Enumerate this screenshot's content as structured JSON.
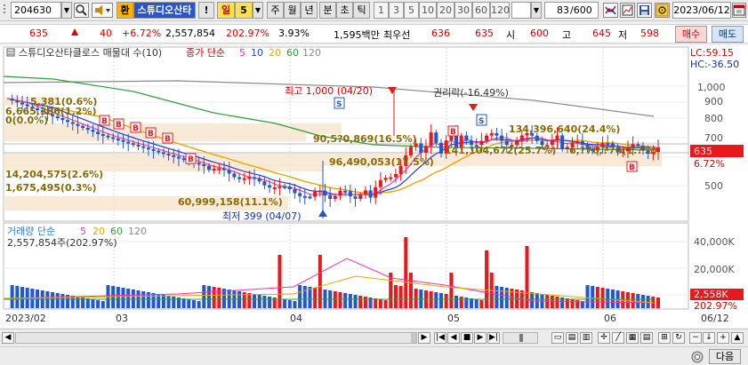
{
  "toolbar": {
    "code": "204630",
    "exchange_btn": "환",
    "stock_name": "스튜디오산타",
    "alert_btn": "!",
    "period_day": "일",
    "period_count": "5",
    "period_week": "주",
    "period_month": "월",
    "period_year": "년",
    "period_minute": "분",
    "period_tick": "초",
    "period_tick2": "틱",
    "intervals": [
      "1",
      "3",
      "5",
      "10",
      "20",
      "30",
      "60",
      "120"
    ],
    "range": "83",
    "range_total": "/600",
    "date": "2023/06/12"
  },
  "quote": {
    "price": "635",
    "change": "40",
    "change_pct": "+6.72%",
    "volume": "2,557,854",
    "volume_pct": "202.97%",
    "rate": "3.93%",
    "amount": "1,595백만",
    "label_best": "최우선",
    "best_ask": "636",
    "best_bid": "635",
    "label_open": "시",
    "open": "600",
    "label_high": "고",
    "high": "645",
    "label_low": "저",
    "low": "598",
    "buy_btn": "매수",
    "sell_btn": "매도"
  },
  "chart": {
    "legend_name": "스튜디오산타클로스 매물대 수(10)",
    "legend_ma_prefix": "종가 단순",
    "ma_labels": [
      "5",
      "10",
      "20",
      "60",
      "120"
    ],
    "lc_label": "LC:59.15",
    "hc_label": "HC:-36.50",
    "y_ticks": [
      "1,000",
      "900",
      "800",
      "700",
      "635",
      "6.72%",
      "500"
    ],
    "annotations": {
      "high": "최고 1,000 (04/20)",
      "low": "최저 399 (04/07)",
      "rights": "권리락(-16.49%)",
      "vp1": "134,396,640(24.4%)",
      "vp2": "90,5?0,869(16.5%)",
      "vp3": "96,490,053(17.5%)",
      "vp4": "141,104,672(25.7%)",
      "vp5": "6,?76,?70(1.?%)",
      "vp6": "5,381(0.6%)",
      "vp7": "6,665,386(1.2%)",
      "vp8": "0(0.0%)",
      "vp9": "14,204,575(2.6%)",
      "vp10": "1,675,495(0.3%)",
      "vp11": "60,999,158(11.1%)"
    },
    "volume_legend": "거래량 단순",
    "volume_ma": [
      "5",
      "20",
      "60",
      "120"
    ],
    "volume_value": "2,557,854주(202.97%)",
    "volume_ticks": [
      "40,000K",
      "20,000K"
    ],
    "volume_current": "2,558K",
    "volume_pct": "202.97%",
    "x_labels": [
      "2023/02",
      "03",
      "04",
      "05",
      "06",
      "06/12"
    ]
  },
  "bottom": {
    "next_btn": "다음"
  },
  "colors": {
    "up": "#e8181c",
    "down": "#2257d2",
    "ma5": "#ff2fa8",
    "ma10": "#1f3fe0",
    "ma20": "#e8a800",
    "ma60": "#2e9e3a",
    "ma120": "#8a8a8a"
  }
}
